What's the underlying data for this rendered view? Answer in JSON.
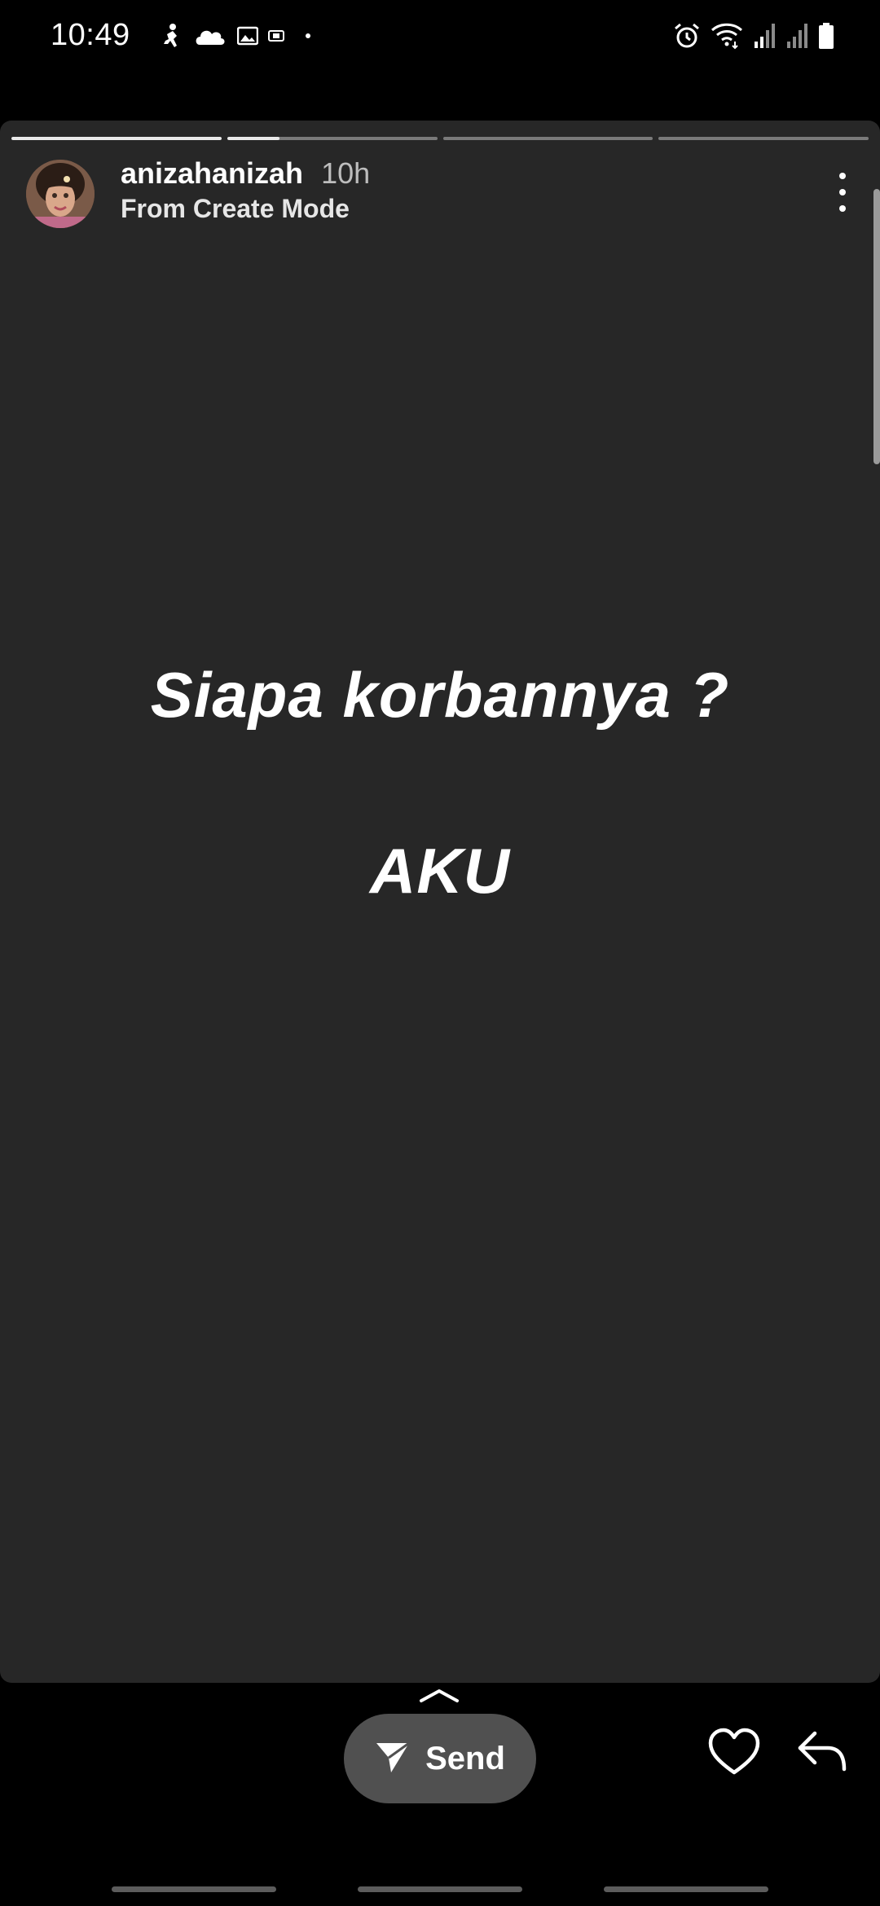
{
  "status_bar": {
    "time": "10:49",
    "left_icons": [
      "running-person-icon",
      "cloud-icon",
      "gallery-icon",
      "screen-record-icon",
      "dot-icon"
    ],
    "right_icons": [
      "alarm-icon",
      "wifi-icon",
      "signal-icon",
      "signal-icon",
      "battery-icon"
    ]
  },
  "story": {
    "segments": [
      {
        "progress": 1.0
      },
      {
        "progress": 0.25
      },
      {
        "progress": 0.0
      },
      {
        "progress": 0.0
      }
    ],
    "username": "anizahanizah",
    "time_ago": "10h",
    "subtitle": "From Create Mode",
    "line1": "Siapa korbannya ?",
    "line2": "AKU",
    "background_color": "#272727"
  },
  "actions": {
    "send_label": "Send",
    "send_icon": "paper-plane-icon",
    "like_icon": "heart-icon",
    "reply_icon": "reply-arrow-icon",
    "swipe_icon": "chevron-up-icon",
    "more_icon": "vertical-dots-icon"
  }
}
